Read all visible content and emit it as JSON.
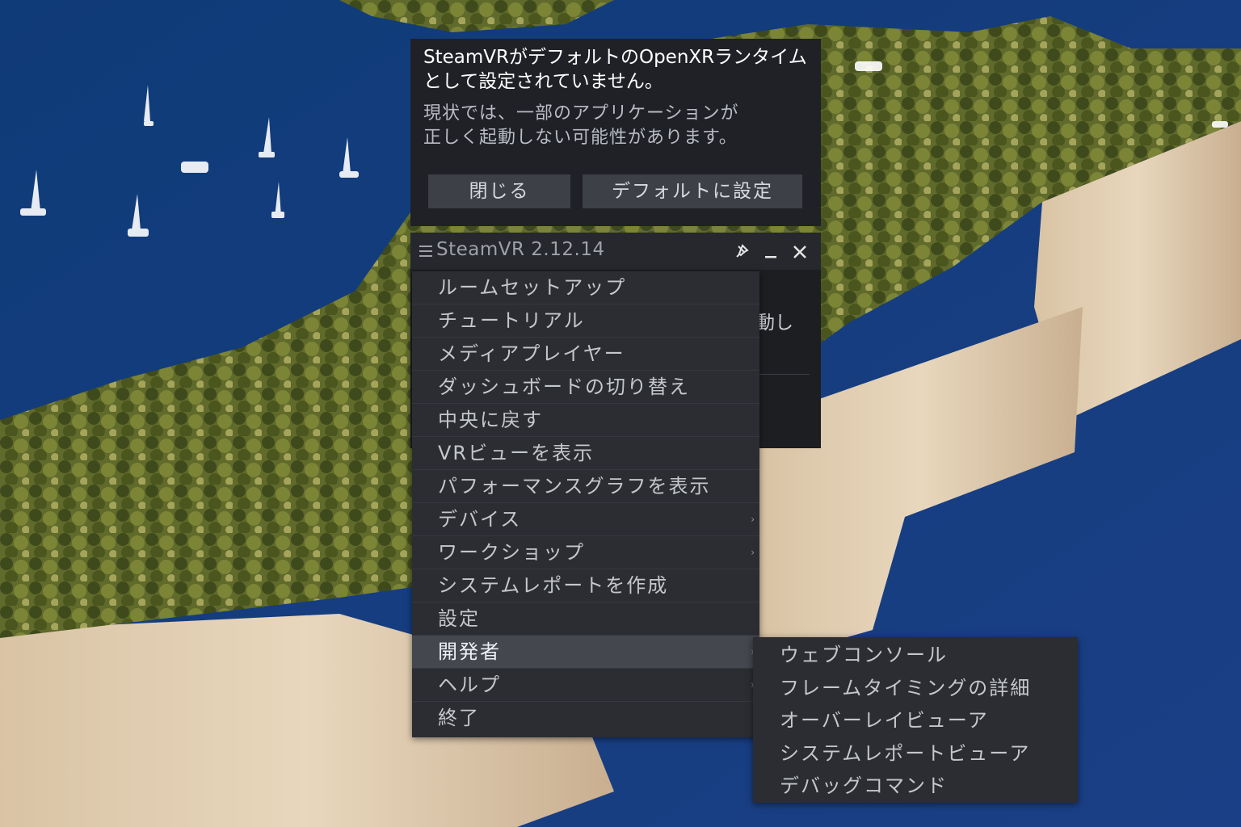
{
  "notification": {
    "headline": "SteamVRがデフォルトのOpenXRランタイムとして設定されていません。",
    "body_line1": "現状では、一部のアプリケーションが",
    "body_line2": "正しく起動しない可能性があります。",
    "close_label": "閉じる",
    "set_default_label": "デフォルトに設定"
  },
  "vr_window": {
    "title": "SteamVR 2.12.14",
    "hidden_text_fragment": "動し",
    "icons": [
      "hamburger-menu-icon",
      "pin-icon",
      "minimize-icon",
      "close-icon"
    ]
  },
  "menu": {
    "items": [
      {
        "label": "ルームセットアップ",
        "submenu": false
      },
      {
        "label": "チュートリアル",
        "submenu": false
      },
      {
        "label": "メディアプレイヤー",
        "submenu": false
      },
      {
        "label": "ダッシュボードの切り替え",
        "submenu": false
      },
      {
        "label": "中央に戻す",
        "submenu": false
      },
      {
        "label": "VRビューを表示",
        "submenu": false
      },
      {
        "label": "パフォーマンスグラフを表示",
        "submenu": false
      },
      {
        "label": "デバイス",
        "submenu": true
      },
      {
        "label": "ワークショップ",
        "submenu": true
      },
      {
        "label": "システムレポートを作成",
        "submenu": false
      },
      {
        "label": "設定",
        "submenu": false
      },
      {
        "label": "開発者",
        "submenu": true,
        "active": true
      },
      {
        "label": "ヘルプ",
        "submenu": true
      },
      {
        "label": "終了",
        "submenu": false
      }
    ]
  },
  "submenu": {
    "items": [
      {
        "label": "ウェブコンソール"
      },
      {
        "label": "フレームタイミングの詳細"
      },
      {
        "label": "オーバーレイビューア"
      },
      {
        "label": "システムレポートビューア"
      },
      {
        "label": "デバッグコマンド"
      }
    ]
  },
  "colors": {
    "panel": "#1f2126",
    "menu_bg": "#2b2d32",
    "menu_active": "#44474e",
    "button_bg": "#3d4047"
  }
}
